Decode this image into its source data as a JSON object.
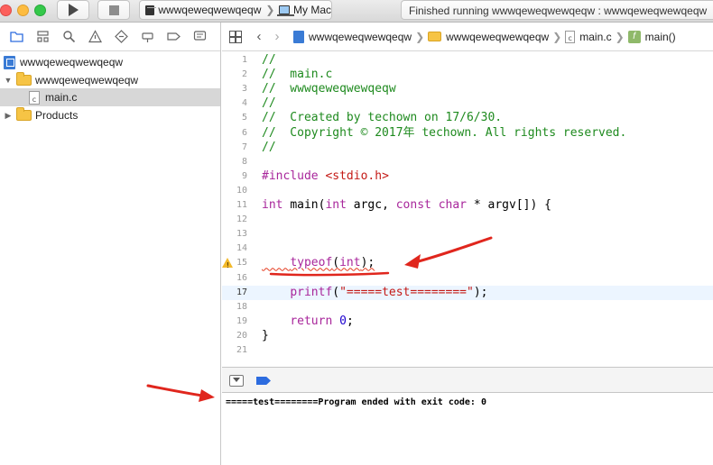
{
  "toolbar": {
    "scheme_name": "wwwqeweqwewqeqw",
    "destination": "My Mac",
    "status": "Finished running wwwqeweqwewqeqw : wwwqeweqwewqeqw"
  },
  "navigator": {
    "project": "wwwqeweqwewqeqw",
    "group": "wwwqeweqwewqeqw",
    "file": "main.c",
    "products": "Products"
  },
  "jumpbar": {
    "project": "wwwqeweqwewqeqw",
    "group": "wwwqeweqwewqeqw",
    "file": "main.c",
    "symbol": "main()",
    "file_letter": "c",
    "func_letter": "f"
  },
  "code": {
    "lines": [
      "//",
      "//  main.c",
      "//  wwwqeweqwewqeqw",
      "//",
      "//  Created by techown on 17/6/30.",
      "//  Copyright © 2017年 techown. All rights reserved.",
      "//",
      "",
      "#include <stdio.h>",
      "",
      "int main(int argc, const char * argv[]) {",
      "",
      "",
      "",
      "    typeof(int);",
      "",
      "    printf(\"=====test========\");",
      "",
      "    return 0;",
      "}",
      ""
    ],
    "numbers": [
      "1",
      "2",
      "3",
      "4",
      "5",
      "6",
      "7",
      "8",
      "9",
      "10",
      "11",
      "12",
      "13",
      "14",
      "15",
      "16",
      "17",
      "18",
      "19",
      "20",
      "21"
    ],
    "current_line": 17,
    "warning_line": 15
  },
  "console": {
    "output": "=====test========Program ended with exit code: 0"
  },
  "colors": {
    "comment": "#1e8a1e",
    "keyword": "#a8269b",
    "string": "#c41a16",
    "number": "#1c00cf",
    "annotation_arrow": "#e0261d"
  }
}
